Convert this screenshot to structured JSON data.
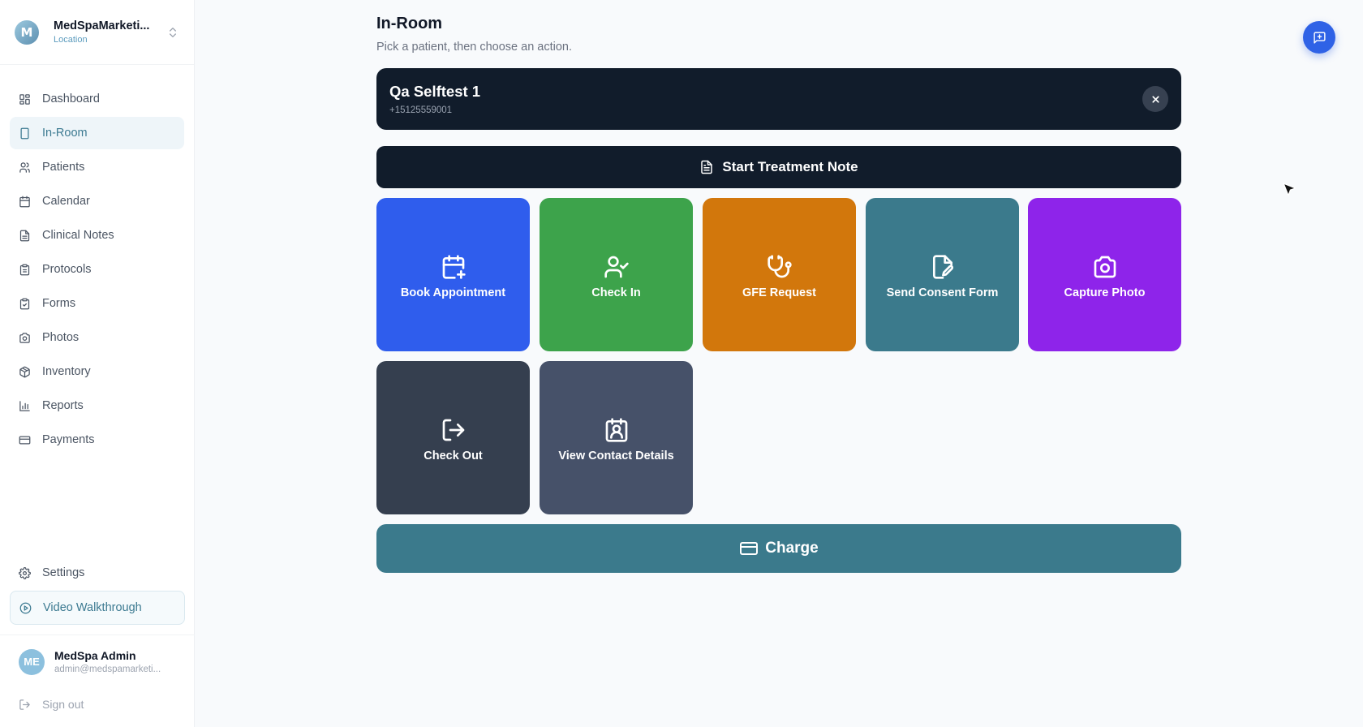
{
  "org": {
    "name": "MedSpaMarketi...",
    "sub": "Location",
    "logo_letter": "M"
  },
  "nav": [
    {
      "key": "dashboard",
      "label": "Dashboard",
      "icon": "dashboard-icon"
    },
    {
      "key": "in-room",
      "label": "In-Room",
      "icon": "tablet-icon",
      "active": true
    },
    {
      "key": "patients",
      "label": "Patients",
      "icon": "users-icon"
    },
    {
      "key": "calendar",
      "label": "Calendar",
      "icon": "calendar-icon"
    },
    {
      "key": "clinical-notes",
      "label": "Clinical Notes",
      "icon": "document-icon"
    },
    {
      "key": "protocols",
      "label": "Protocols",
      "icon": "clipboard-icon"
    },
    {
      "key": "forms",
      "label": "Forms",
      "icon": "clipboard-check-icon"
    },
    {
      "key": "photos",
      "label": "Photos",
      "icon": "camera-icon"
    },
    {
      "key": "inventory",
      "label": "Inventory",
      "icon": "package-icon"
    },
    {
      "key": "reports",
      "label": "Reports",
      "icon": "bar-chart-icon"
    },
    {
      "key": "payments",
      "label": "Payments",
      "icon": "credit-card-icon"
    }
  ],
  "bottom": {
    "settings_label": "Settings",
    "walkthrough_label": "Video Walkthrough",
    "user": {
      "initials": "ME",
      "name": "MedSpa Admin",
      "email": "admin@medspamarketi..."
    },
    "signout_label": "Sign out"
  },
  "page": {
    "title": "In-Room",
    "subtitle": "Pick a patient, then choose an action."
  },
  "patient": {
    "name": "Qa Selftest 1",
    "phone": "+15125559001"
  },
  "treatment_label": "Start Treatment Note",
  "actions": [
    {
      "label": "Book Appointment",
      "icon": "calendar-plus-icon",
      "color": "#2f5ded"
    },
    {
      "label": "Check In",
      "icon": "user-check-icon",
      "color": "#3da34b"
    },
    {
      "label": "GFE Request",
      "icon": "stethoscope-icon",
      "color": "#d2770c"
    },
    {
      "label": "Send Consent Form",
      "icon": "file-signature-icon",
      "color": "#3b7a8c"
    },
    {
      "label": "Capture Photo",
      "icon": "camera-icon",
      "color": "#8e24ea"
    },
    {
      "label": "Check Out",
      "icon": "logout-icon",
      "color": "#353f4f"
    },
    {
      "label": "View Contact Details",
      "icon": "contact-card-icon",
      "color": "#465169"
    }
  ],
  "charge_label": "Charge",
  "colors": {
    "accent": "#3b7a8c",
    "dark": "#111c2b",
    "fab": "#2f62e6"
  }
}
